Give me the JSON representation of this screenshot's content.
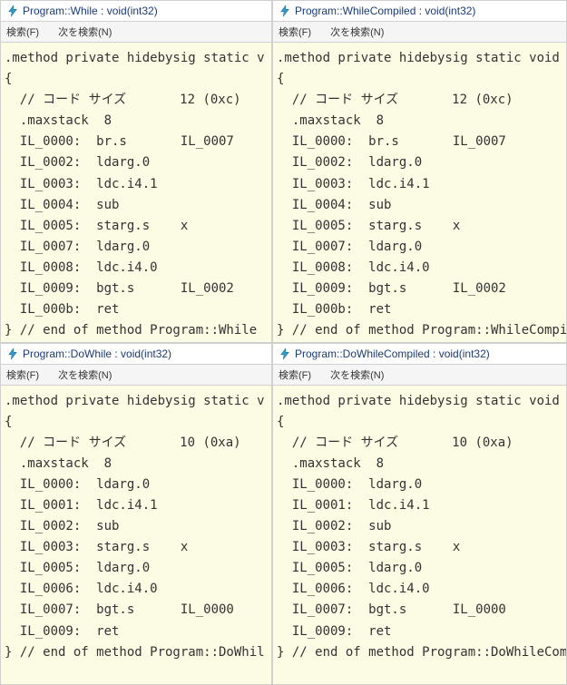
{
  "menus": {
    "search": "検索(F)",
    "search_next": "次を検索(N)"
  },
  "panels": [
    {
      "title": "Program::While : void(int32)",
      "code": ".method private hidebysig static v\n{\n  // コード サイズ       12 (0xc)\n  .maxstack  8\n  IL_0000:  br.s       IL_0007\n  IL_0002:  ldarg.0\n  IL_0003:  ldc.i4.1\n  IL_0004:  sub\n  IL_0005:  starg.s    x\n  IL_0007:  ldarg.0\n  IL_0008:  ldc.i4.0\n  IL_0009:  bgt.s      IL_0002\n  IL_000b:  ret\n} // end of method Program::While"
    },
    {
      "title": "Program::WhileCompiled : void(int32)",
      "code": ".method private hidebysig static void  While\n{\n  // コード サイズ       12 (0xc)\n  .maxstack  8\n  IL_0000:  br.s       IL_0007\n  IL_0002:  ldarg.0\n  IL_0003:  ldc.i4.1\n  IL_0004:  sub\n  IL_0005:  starg.s    x\n  IL_0007:  ldarg.0\n  IL_0008:  ldc.i4.0\n  IL_0009:  bgt.s      IL_0002\n  IL_000b:  ret\n} // end of method Program::WhileCompiled"
    },
    {
      "title": "Program::DoWhile : void(int32)",
      "code": ".method private hidebysig static v\n{\n  // コード サイズ       10 (0xa)\n  .maxstack  8\n  IL_0000:  ldarg.0\n  IL_0001:  ldc.i4.1\n  IL_0002:  sub\n  IL_0003:  starg.s    x\n  IL_0005:  ldarg.0\n  IL_0006:  ldc.i4.0\n  IL_0007:  bgt.s      IL_0000\n  IL_0009:  ret\n} // end of method Program::DoWhil"
    },
    {
      "title": "Program::DoWhileCompiled : void(int32)",
      "code": ".method private hidebysig static void  DoWhi\n{\n  // コード サイズ       10 (0xa)\n  .maxstack  8\n  IL_0000:  ldarg.0\n  IL_0001:  ldc.i4.1\n  IL_0002:  sub\n  IL_0003:  starg.s    x\n  IL_0005:  ldarg.0\n  IL_0006:  ldc.i4.0\n  IL_0007:  bgt.s      IL_0000\n  IL_0009:  ret\n} // end of method Program::DoWhileCompiled"
    }
  ]
}
